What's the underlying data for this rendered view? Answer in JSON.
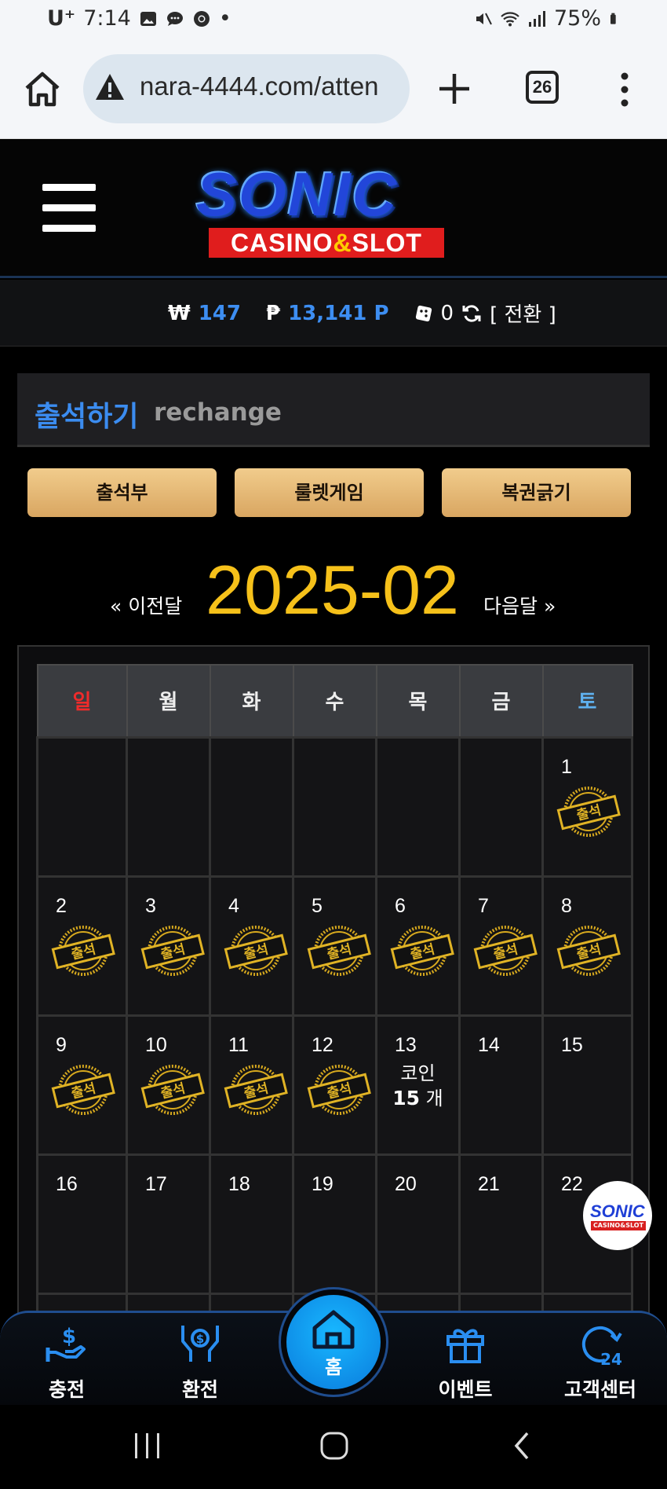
{
  "status_bar": {
    "carrier": "U⁺",
    "time": "7:14",
    "battery": "75%"
  },
  "browser": {
    "url": "nara-4444.com/atten",
    "tab_count": "26"
  },
  "site": {
    "logo_main": "SONIC",
    "logo_sub_left": "CASINO",
    "logo_sub_amp": "&",
    "logo_sub_right": "SLOT"
  },
  "balance": {
    "won_symbol": "₩",
    "won_value": "147",
    "point_symbol": "₱",
    "point_value": "13,141 P",
    "ticket_value": "0",
    "convert_label": "[ 전환 ]"
  },
  "section": {
    "title_ko": "출석하기",
    "title_en": "rechange"
  },
  "tabs": [
    {
      "label": "출석부"
    },
    {
      "label": "룰렛게임"
    },
    {
      "label": "복권긁기"
    }
  ],
  "calendar": {
    "prev_label": "« 이전달",
    "month": "2025-02",
    "next_label": "다음달 »",
    "weekdays": [
      "일",
      "월",
      "화",
      "수",
      "목",
      "금",
      "토"
    ],
    "stamp_text": "출석",
    "coin_label": "코인",
    "coin_count": "15",
    "coin_unit": "개",
    "rows": [
      [
        "",
        "",
        "",
        "",
        "",
        "",
        "1"
      ],
      [
        "2",
        "3",
        "4",
        "5",
        "6",
        "7",
        "8"
      ],
      [
        "9",
        "10",
        "11",
        "12",
        "13",
        "14",
        "15"
      ],
      [
        "16",
        "17",
        "18",
        "19",
        "20",
        "21",
        "22"
      ],
      [
        "",
        "",
        "",
        "",
        "",
        "",
        ""
      ]
    ],
    "attended": [
      "1",
      "2",
      "3",
      "4",
      "5",
      "6",
      "7",
      "8",
      "9",
      "10",
      "11",
      "12"
    ],
    "today": "13"
  },
  "floating": {
    "logo_main": "SONIC",
    "logo_sub": "CASINO&SLOT"
  },
  "bottom_nav": {
    "charge": "충전",
    "exchange": "환전",
    "home": "홈",
    "event": "이벤트",
    "support": "고객센터",
    "support_badge": "24"
  },
  "colors": {
    "accent_blue": "#3b8cf0",
    "gold": "#f6c11a",
    "button_gold": "#e4b877",
    "sunday_red": "#ef2b2b",
    "saturday_blue": "#5fb1ef"
  }
}
